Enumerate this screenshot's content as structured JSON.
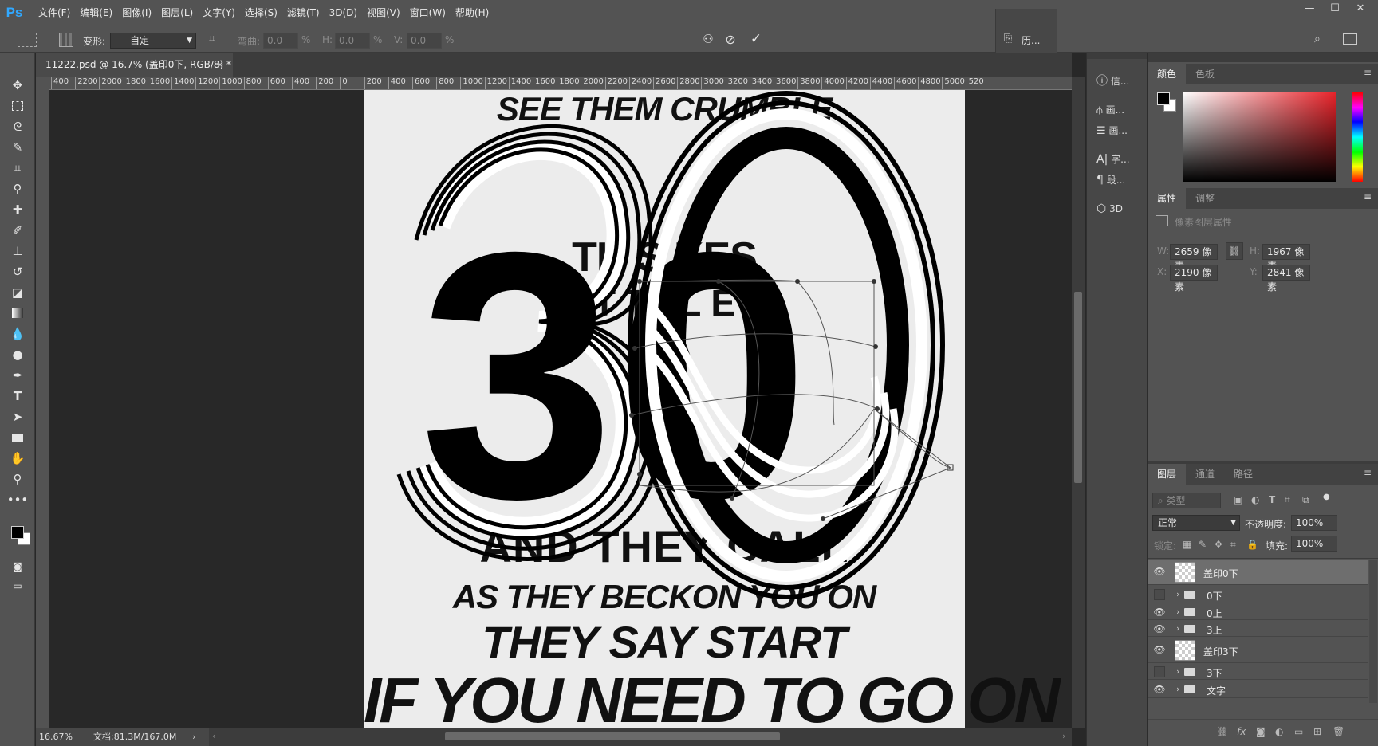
{
  "app": {
    "logo": "Ps"
  },
  "menu": [
    "文件(F)",
    "编辑(E)",
    "图像(I)",
    "图层(L)",
    "文字(Y)",
    "选择(S)",
    "滤镜(T)",
    "3D(D)",
    "视图(V)",
    "窗口(W)",
    "帮助(H)"
  ],
  "options": {
    "warp_label": "变形:",
    "warp_value": "自定",
    "bend_label": "弯曲:",
    "bend_value": "0.0",
    "bend_unit": "%",
    "h_label": "H:",
    "h_value": "0.0",
    "h_unit": "%",
    "v_label": "V:",
    "v_value": "0.0",
    "v_unit": "%",
    "history_label": "历..."
  },
  "document": {
    "tab_title": "11222.psd @ 16.7% (盖印0下, RGB/8) *",
    "zoom": "16.67%",
    "doc_size": "文档:81.3M/167.0M"
  },
  "ruler_h": [
    "400",
    "2200",
    "2000",
    "1800",
    "1600",
    "1400",
    "1200",
    "1000",
    "800",
    "600",
    "400",
    "200",
    "0",
    "200",
    "400",
    "600",
    "800",
    "1000",
    "1200",
    "1400",
    "1600",
    "1800",
    "2000",
    "2200",
    "2400",
    "2600",
    "2800",
    "3000",
    "3200",
    "3400",
    "3600",
    "3800",
    "4000",
    "4200",
    "4400",
    "4600",
    "4800",
    "5000",
    "520"
  ],
  "artwork": {
    "lines": [
      "SEE THEM CRUMBLE",
      "TH        S     KES",
      "T    T  I  L  E",
      "S    A",
      "AND THEY CALL",
      "AS THEY BECKON YOU ON",
      "THEY SAY START",
      "IF YOU NEED TO GO ON"
    ],
    "big_number": "30"
  },
  "mid_panel": [
    {
      "icon": "info-icon",
      "label": "信..."
    },
    {
      "icon": "brush-preset-icon",
      "label": "画..."
    },
    {
      "icon": "brush-settings-icon",
      "label": "画..."
    },
    {
      "icon": "character-icon",
      "label": "字..."
    },
    {
      "icon": "paragraph-icon",
      "label": "段..."
    },
    {
      "icon": "3d-icon",
      "label": "3D"
    }
  ],
  "color_panel": {
    "tabs": [
      "颜色",
      "色板"
    ]
  },
  "properties_panel": {
    "tabs": [
      "属性",
      "调整"
    ],
    "title": "像素图层属性",
    "w_label": "W:",
    "w_value": "2659 像素",
    "h_label": "H:",
    "h_value": "1967 像素",
    "x_label": "X:",
    "x_value": "2190 像素",
    "y_label": "Y:",
    "y_value": "2841 像素"
  },
  "layers_panel": {
    "tabs": [
      "图层",
      "通道",
      "路径"
    ],
    "filter_placeholder": "类型",
    "blend_mode": "正常",
    "opacity_label": "不透明度:",
    "opacity_value": "100%",
    "lock_label": "锁定:",
    "fill_label": "填充:",
    "fill_value": "100%",
    "layers": [
      {
        "name": "盖印0下",
        "type": "pixel",
        "visible": true,
        "selected": true
      },
      {
        "name": "0下",
        "type": "group",
        "visible": false
      },
      {
        "name": "0上",
        "type": "group",
        "visible": true
      },
      {
        "name": "3上",
        "type": "group",
        "visible": true
      },
      {
        "name": "盖印3下",
        "type": "pixel",
        "visible": true
      },
      {
        "name": "3下",
        "type": "group",
        "visible": false
      },
      {
        "name": "文字",
        "type": "group",
        "visible": true
      }
    ]
  },
  "colors": {
    "accent": "#31a8ff",
    "panel": "#535353",
    "dark": "#282828",
    "artboard": "#ececec"
  }
}
